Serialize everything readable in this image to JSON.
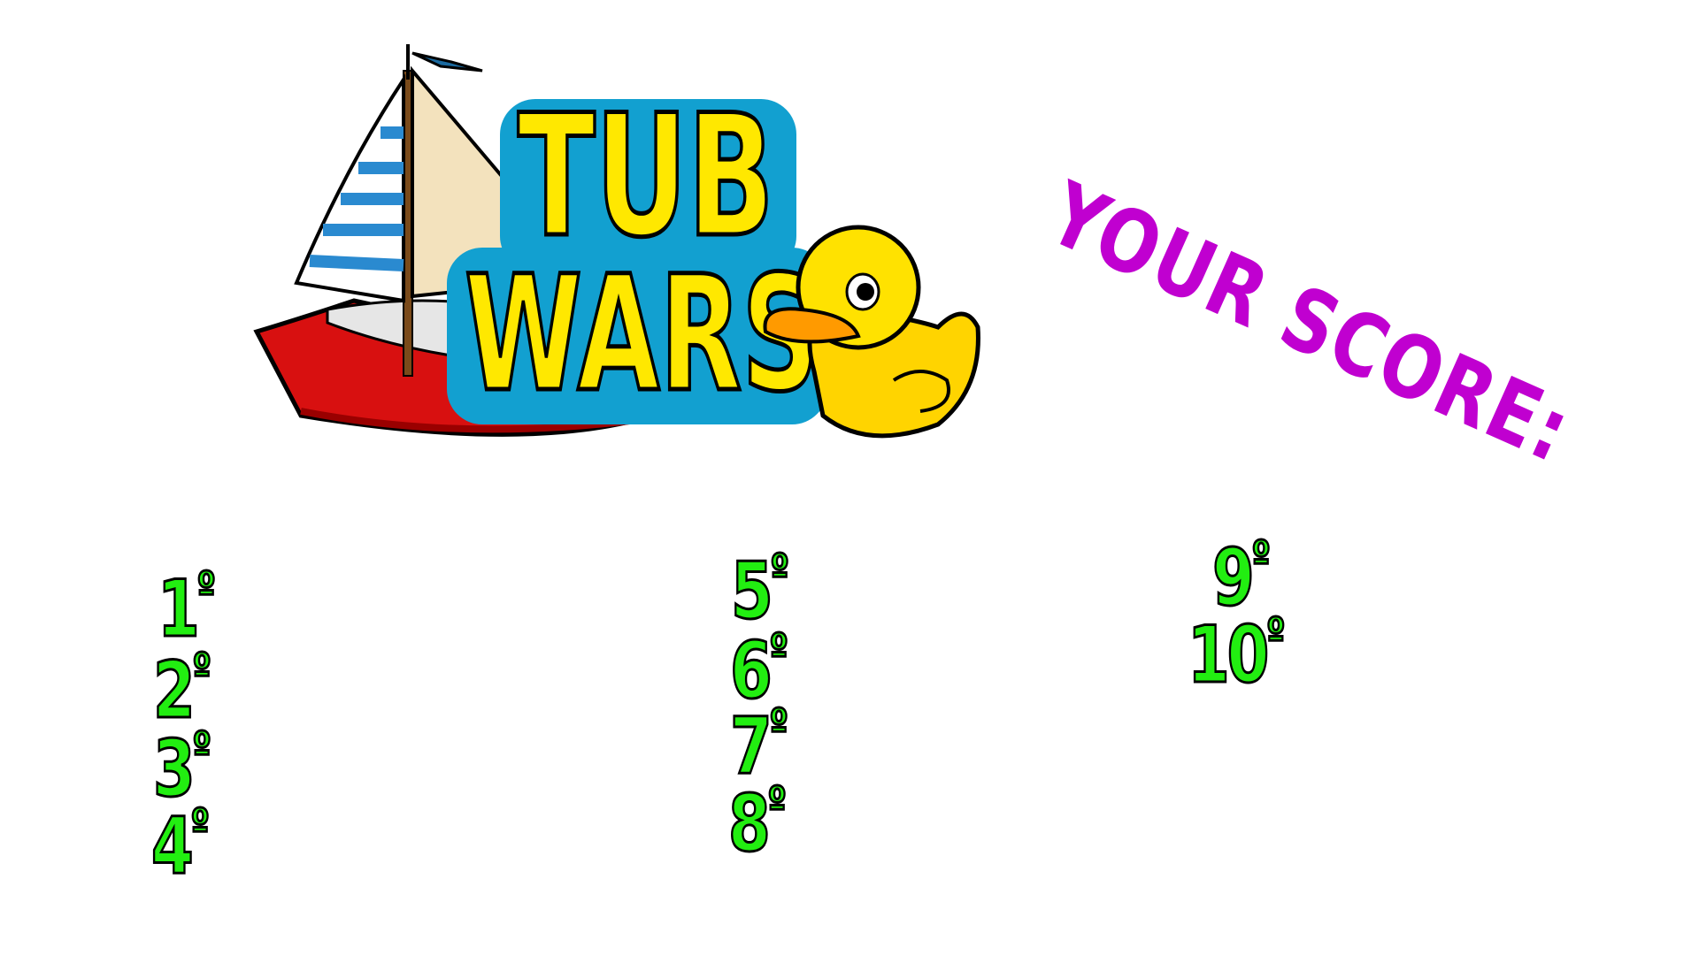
{
  "logo": {
    "line1": "TUB",
    "line2": "WARS"
  },
  "score_heading": "YOUR SCORE:",
  "colors": {
    "heading": "#c000d0",
    "ranks": "#22ee11",
    "logo_text": "#ffe800",
    "logo_outline": "#12a0d0"
  },
  "ranks": [
    {
      "number": "1",
      "suffix": "º"
    },
    {
      "number": "2",
      "suffix": "º"
    },
    {
      "number": "3",
      "suffix": "º"
    },
    {
      "number": "4",
      "suffix": "º"
    },
    {
      "number": "5",
      "suffix": "º"
    },
    {
      "number": "6",
      "suffix": "º"
    },
    {
      "number": "7",
      "suffix": "º"
    },
    {
      "number": "8",
      "suffix": "º"
    },
    {
      "number": "9",
      "suffix": "º"
    },
    {
      "number": "10",
      "suffix": "º"
    }
  ]
}
